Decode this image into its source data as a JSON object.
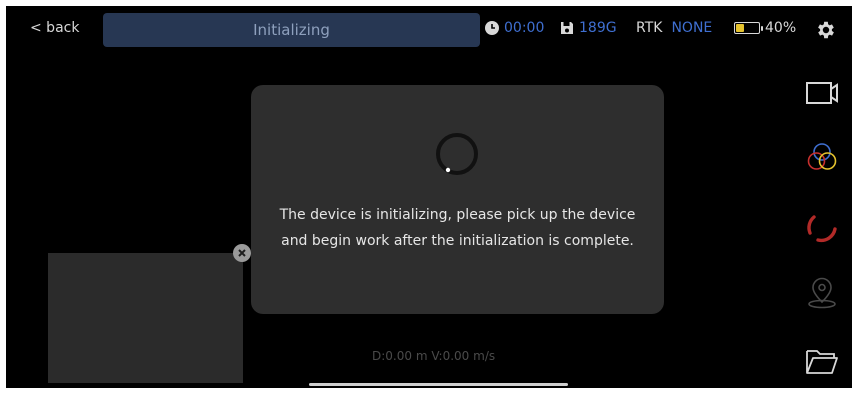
{
  "topbar": {
    "back_label": "< back",
    "status_title": "Initializing",
    "timer": "00:00",
    "storage": "189G",
    "rtk_label": "RTK",
    "rtk_value": "NONE",
    "battery_percent": "40%",
    "battery_level": 0.4
  },
  "modal": {
    "message": "The device is initializing, please pick up the device and begin work after the initialization is complete."
  },
  "telemetry": "D:0.00 m V:0.00 m/s",
  "sidebar": {
    "icons": [
      "video-camera-icon",
      "color-circles-icon",
      "lidar-scan-icon",
      "location-pin-icon",
      "folder-icon"
    ]
  },
  "colors": {
    "accent_blue": "#3f6fd1",
    "status_pill": "#273753",
    "battery_yellow": "#e5c32e",
    "scan_red": "#c8302e"
  }
}
